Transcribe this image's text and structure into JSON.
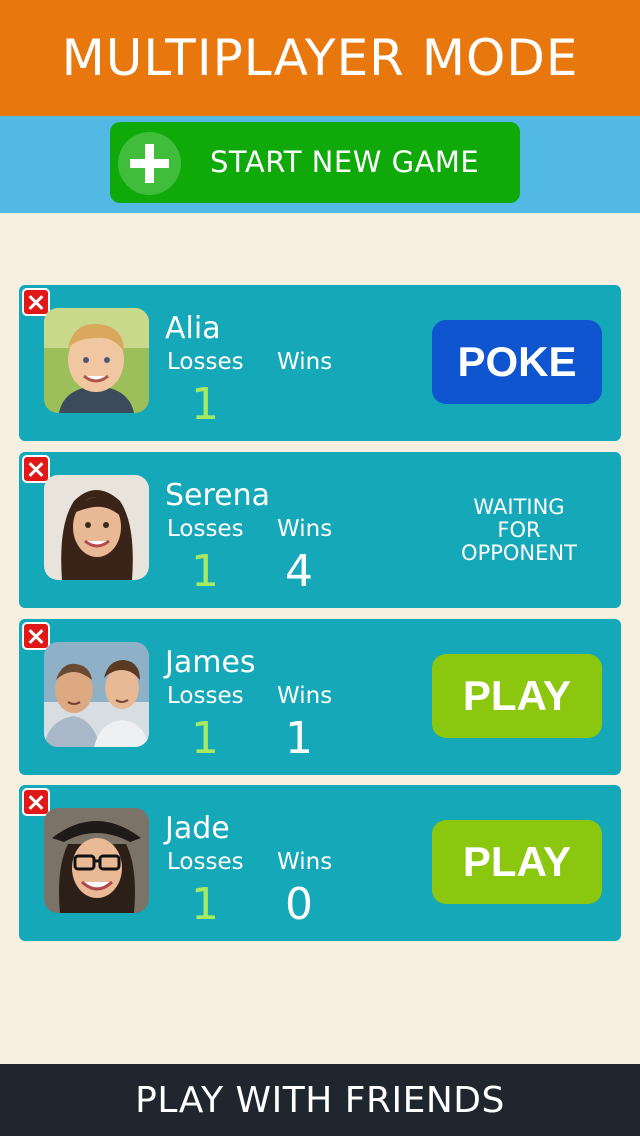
{
  "header": {
    "title": "MULTIPLAYER MODE"
  },
  "start_button": {
    "label": "START NEW GAME",
    "icon": "plus-icon"
  },
  "players": [
    {
      "name": "Alia",
      "losses_label": "Losses",
      "wins_label": "Wins",
      "losses": "1",
      "wins": "",
      "action": "POKE",
      "action_type": "poke"
    },
    {
      "name": "Serena",
      "losses_label": "Losses",
      "wins_label": "Wins",
      "losses": "1",
      "wins": "4",
      "status_lines": [
        "WAITING",
        "FOR",
        "OPPONENT"
      ]
    },
    {
      "name": "James",
      "losses_label": "Losses",
      "wins_label": "Wins",
      "losses": "1",
      "wins": "1",
      "action": "PLAY",
      "action_type": "play"
    },
    {
      "name": "Jade",
      "losses_label": "Losses",
      "wins_label": "Wins",
      "losses": "1",
      "wins": "0",
      "action": "PLAY",
      "action_type": "play"
    }
  ],
  "footer": {
    "text": "PLAY WITH FRIENDS"
  },
  "colors": {
    "header": "#e8780e",
    "band": "#52b8e4",
    "start_button": "#0faa0a",
    "card": "#15a8b8",
    "poke_button": "#0f55d0",
    "play_button": "#8cc70f",
    "losses_value": "#a6ea63",
    "footer": "#20262e",
    "background": "#f7efe0"
  }
}
